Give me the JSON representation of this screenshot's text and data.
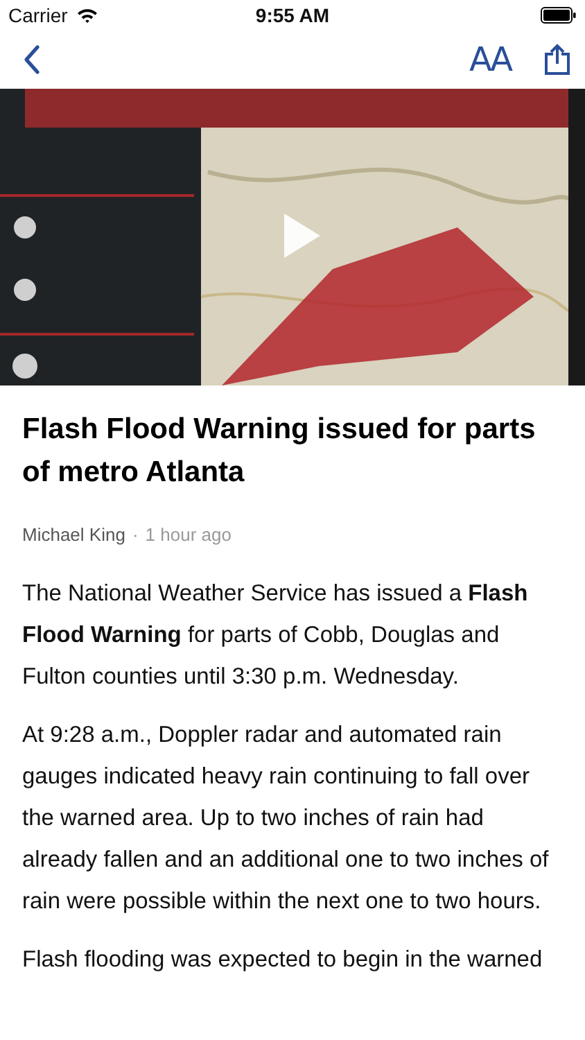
{
  "status_bar": {
    "carrier": "Carrier",
    "time": "9:55 AM"
  },
  "nav": {
    "text_size_label": "AA"
  },
  "media": {
    "kind": "picture",
    "playable": true
  },
  "article": {
    "title": "Flash Flood Warning issued for parts of metro Atlanta",
    "author": "Michael King",
    "separator": "·",
    "time": "1 hour ago",
    "paragraphs": [
      "The National Weather Service has issued a **Flash Flood Warning** for parts of Cobb, Douglas and Fulton counties until 3:30 p.m. Wednesday.",
      "At 9:28 a.m., Doppler radar and automated rain gauges indicated heavy rain continuing to fall over the warned area. Up to two inches of rain had already fallen and an additional one to two inches of rain were possible within the next one to two hours.",
      "Flash flooding was expected to begin in the warned"
    ]
  }
}
